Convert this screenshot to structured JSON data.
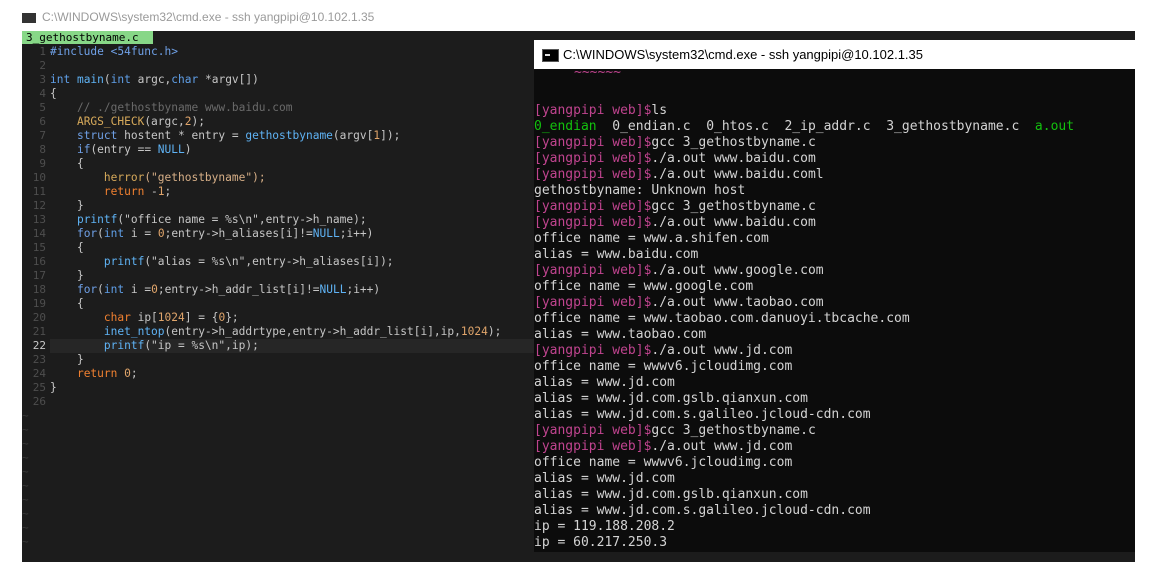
{
  "background_title": "C:\\WINDOWS\\system32\\cmd.exe - ssh  yangpipi@10.102.1.35",
  "editor": {
    "tab_label": "3_gethostbyname.c",
    "line_numbers": [
      "1",
      "2",
      "3",
      "4",
      "5",
      "6",
      "7",
      "8",
      "9",
      "10",
      "11",
      "12",
      "13",
      "14",
      "15",
      "16",
      "17",
      "18",
      "19",
      "20",
      "21",
      "22",
      "23",
      "24",
      "25",
      "26"
    ],
    "tilde": "~",
    "lines": [
      [
        {
          "t": "#include <54func.h>",
          "c": "kw"
        }
      ],
      [],
      [
        {
          "t": "int ",
          "c": "ty"
        },
        {
          "t": "main",
          "c": "fn"
        },
        {
          "t": "("
        },
        {
          "t": "int",
          "c": "ty"
        },
        {
          "t": " argc,"
        },
        {
          "t": "char",
          "c": "ty"
        },
        {
          "t": " *argv[])"
        }
      ],
      [
        {
          "t": "{"
        }
      ],
      [
        {
          "t": "    // ./gethostbyname www.baidu.com",
          "c": "cmt"
        }
      ],
      [
        {
          "t": "    "
        },
        {
          "t": "ARGS_CHECK",
          "c": "mac"
        },
        {
          "t": "(argc,"
        },
        {
          "t": "2",
          "c": "num"
        },
        {
          "t": ");"
        }
      ],
      [
        {
          "t": "    "
        },
        {
          "t": "struct",
          "c": "kw"
        },
        {
          "t": " hostent * entry = "
        },
        {
          "t": "gethostbyname",
          "c": "fn"
        },
        {
          "t": "(argv["
        },
        {
          "t": "1",
          "c": "num"
        },
        {
          "t": "]);"
        }
      ],
      [
        {
          "t": "    "
        },
        {
          "t": "if",
          "c": "kw"
        },
        {
          "t": "(entry == "
        },
        {
          "t": "NULL",
          "c": "fn"
        },
        {
          "t": ")"
        }
      ],
      [
        {
          "t": "    {"
        }
      ],
      [
        {
          "t": "        "
        },
        {
          "t": "herror",
          "c": "mac"
        },
        {
          "t": "(\"gethostbyname\");",
          "c": "str"
        }
      ],
      [
        {
          "t": "        "
        },
        {
          "t": "return",
          "c": "nul"
        },
        {
          "t": " -"
        },
        {
          "t": "1",
          "c": "num"
        },
        {
          "t": ";"
        }
      ],
      [
        {
          "t": "    }"
        }
      ],
      [
        {
          "t": "    "
        },
        {
          "t": "printf",
          "c": "fn"
        },
        {
          "t": "(\"office name = %s\\n\","
        },
        {
          "t": "entry->h_name);"
        }
      ],
      [
        {
          "t": "    "
        },
        {
          "t": "for",
          "c": "kw"
        },
        {
          "t": "("
        },
        {
          "t": "int",
          "c": "ty"
        },
        {
          "t": " i = "
        },
        {
          "t": "0",
          "c": "num"
        },
        {
          "t": ";entry->h_aliases[i]!="
        },
        {
          "t": "NULL",
          "c": "fn"
        },
        {
          "t": ";i++)"
        }
      ],
      [
        {
          "t": "    {"
        }
      ],
      [
        {
          "t": "        "
        },
        {
          "t": "printf",
          "c": "fn"
        },
        {
          "t": "(\"alias = %s\\n\","
        },
        {
          "t": "entry->h_aliases[i]);"
        }
      ],
      [
        {
          "t": "    }"
        }
      ],
      [
        {
          "t": "    "
        },
        {
          "t": "for",
          "c": "kw"
        },
        {
          "t": "("
        },
        {
          "t": "int",
          "c": "ty"
        },
        {
          "t": " i ="
        },
        {
          "t": "0",
          "c": "num"
        },
        {
          "t": ";entry->h_addr_list[i]!="
        },
        {
          "t": "NULL",
          "c": "fn"
        },
        {
          "t": ";i++)"
        }
      ],
      [
        {
          "t": "    {"
        }
      ],
      [
        {
          "t": "        "
        },
        {
          "t": "char",
          "c": "nul"
        },
        {
          "t": " ip["
        },
        {
          "t": "1024",
          "c": "num"
        },
        {
          "t": "] = {"
        },
        {
          "t": "0",
          "c": "num"
        },
        {
          "t": "};"
        }
      ],
      [
        {
          "t": "        "
        },
        {
          "t": "inet_ntop",
          "c": "fn"
        },
        {
          "t": "(entry->h_addrtype,entry->h_addr_list[i],ip,"
        },
        {
          "t": "1024",
          "c": "num"
        },
        {
          "t": ");"
        }
      ],
      [
        {
          "t": "        "
        },
        {
          "t": "printf",
          "c": "fn"
        },
        {
          "t": "(\"ip = %s\\n\",ip);"
        }
      ],
      [
        {
          "t": "    }"
        }
      ],
      [
        {
          "t": "    "
        },
        {
          "t": "return",
          "c": "nul"
        },
        {
          "t": " "
        },
        {
          "t": "0",
          "c": "num"
        },
        {
          "t": ";"
        }
      ],
      [
        {
          "t": "}"
        }
      ],
      []
    ]
  },
  "cmd": {
    "title": "C:\\WINDOWS\\system32\\cmd.exe - ssh  yangpipi@10.102.1.35",
    "prompt": "[yangpipi web]$",
    "lines": [
      [
        {
          "t": "[yangpipi web]$",
          "c": "pr"
        },
        {
          "t": "ls"
        }
      ],
      [
        {
          "t": "0_endian",
          "c": "gr"
        },
        {
          "t": "  0_endian.c  0_htos.c  2_ip_addr.c  3_gethostbyname.c  "
        },
        {
          "t": "a.out",
          "c": "gr"
        }
      ],
      [
        {
          "t": "[yangpipi web]$",
          "c": "pr"
        },
        {
          "t": "gcc 3_gethostbyname.c"
        }
      ],
      [
        {
          "t": "[yangpipi web]$",
          "c": "pr"
        },
        {
          "t": "./a.out www.baidu.com"
        }
      ],
      [
        {
          "t": "[yangpipi web]$",
          "c": "pr"
        },
        {
          "t": "./a.out www.baidu.coml"
        }
      ],
      [
        {
          "t": "gethostbyname: Unknown host"
        }
      ],
      [
        {
          "t": "[yangpipi web]$",
          "c": "pr"
        },
        {
          "t": "gcc 3_gethostbyname.c"
        }
      ],
      [
        {
          "t": "[yangpipi web]$",
          "c": "pr"
        },
        {
          "t": "./a.out www.baidu.com"
        }
      ],
      [
        {
          "t": "office name = www.a.shifen.com"
        }
      ],
      [
        {
          "t": "alias = www.baidu.com"
        }
      ],
      [
        {
          "t": "[yangpipi web]$",
          "c": "pr"
        },
        {
          "t": "./a.out www.google.com"
        }
      ],
      [
        {
          "t": "office name = www.google.com"
        }
      ],
      [
        {
          "t": "[yangpipi web]$",
          "c": "pr"
        },
        {
          "t": "./a.out www.taobao.com"
        }
      ],
      [
        {
          "t": "office name = www.taobao.com.danuoyi.tbcache.com"
        }
      ],
      [
        {
          "t": "alias = www.taobao.com"
        }
      ],
      [
        {
          "t": "[yangpipi web]$",
          "c": "pr"
        },
        {
          "t": "./a.out www.jd.com"
        }
      ],
      [
        {
          "t": "office name = wwwv6.jcloudimg.com"
        }
      ],
      [
        {
          "t": "alias = www.jd.com"
        }
      ],
      [
        {
          "t": "alias = www.jd.com.gslb.qianxun.com"
        }
      ],
      [
        {
          "t": "alias = www.jd.com.s.galileo.jcloud-cdn.com"
        }
      ],
      [
        {
          "t": "[yangpipi web]$",
          "c": "pr"
        },
        {
          "t": "gcc 3_gethostbyname.c"
        }
      ],
      [
        {
          "t": "[yangpipi web]$",
          "c": "pr"
        },
        {
          "t": "./a.out www.jd.com"
        }
      ],
      [
        {
          "t": "office name = wwwv6.jcloudimg.com"
        }
      ],
      [
        {
          "t": "alias = www.jd.com"
        }
      ],
      [
        {
          "t": "alias = www.jd.com.gslb.qianxun.com"
        }
      ],
      [
        {
          "t": "alias = www.jd.com.s.galileo.jcloud-cdn.com"
        }
      ],
      [
        {
          "t": "ip = 119.188.208.2"
        }
      ],
      [
        {
          "t": "ip = 60.217.250.3"
        }
      ],
      [
        {
          "t": "[yangpipi web]$",
          "c": "pr"
        }
      ]
    ]
  }
}
